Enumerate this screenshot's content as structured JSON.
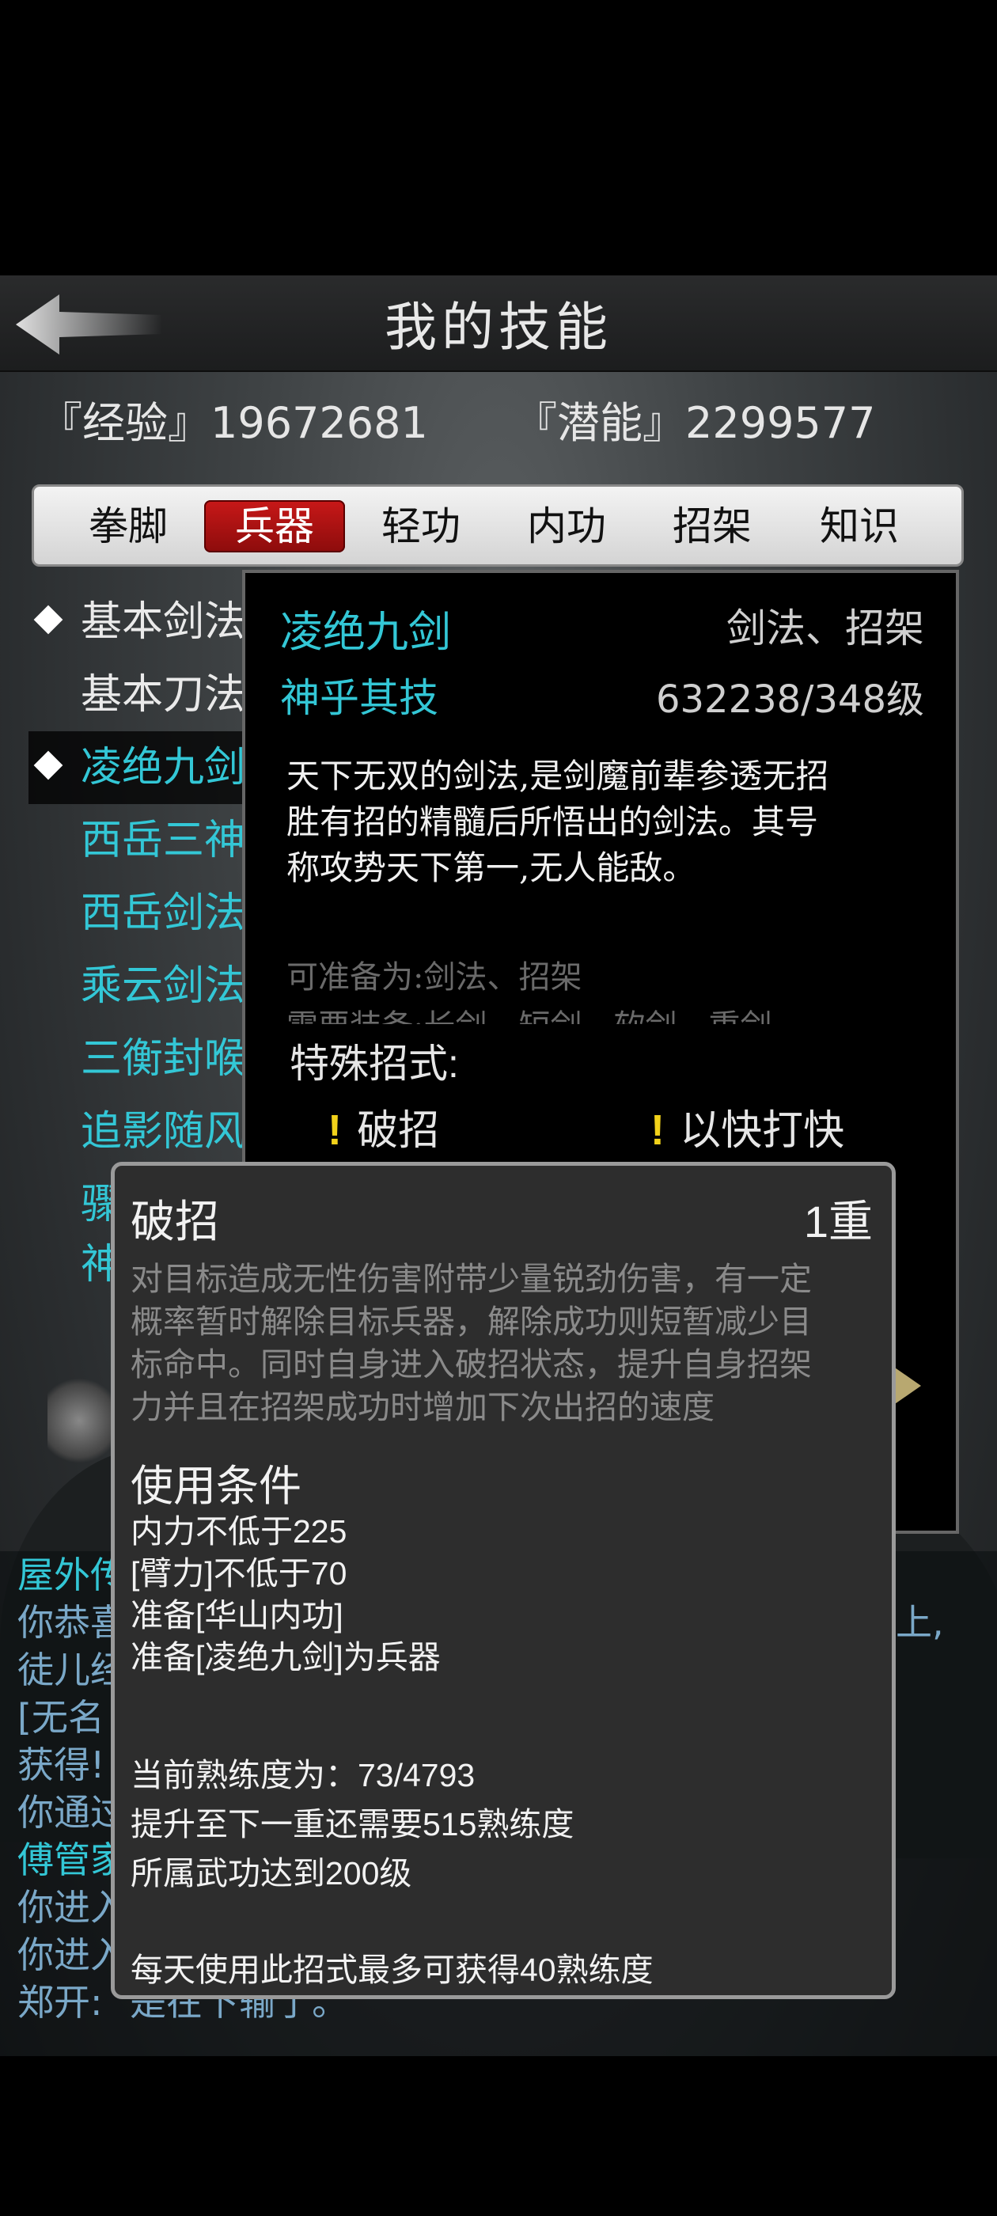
{
  "header": {
    "title": "我的技能"
  },
  "stats": {
    "exp_label": "『经验』19672681",
    "potential_label": "『潜能』2299577"
  },
  "tabs": [
    {
      "label": "拳脚"
    },
    {
      "label": "兵器"
    },
    {
      "label": "轻功"
    },
    {
      "label": "内功"
    },
    {
      "label": "招架"
    },
    {
      "label": "知识"
    }
  ],
  "active_tab": "兵器",
  "skill_list": [
    {
      "label": "基本剑法"
    },
    {
      "label": "基本刀法"
    },
    {
      "label": "凌绝九剑"
    },
    {
      "label": "西岳三神"
    },
    {
      "label": "西岳剑法"
    },
    {
      "label": "乘云剑法"
    },
    {
      "label": "三衡封喉"
    },
    {
      "label": "追影随风"
    },
    {
      "label": "骤"
    },
    {
      "label": "神"
    }
  ],
  "detail": {
    "name": "凌绝九剑",
    "type": "剑法、招架",
    "rank": "神乎其技",
    "progress": "632238/348级",
    "desc_lines": [
      "天下无双的剑法,是剑魔前辈参透无招",
      "胜有招的精髓后所悟出的剑法。其号",
      "称攻势天下第一,无人能敌。"
    ],
    "equip_as": "可准备为:剑法、招架",
    "equip_need": "需要装备:长剑、短剑、软剑、重剑",
    "special_title": "特殊招式:",
    "special_moves": [
      {
        "label": "破招"
      },
      {
        "label": "以快打快"
      }
    ]
  },
  "log": {
    "lines": [
      {
        "text": "屋外传",
        "color": "#33c7d6"
      },
      {
        "text": "你恭喜",
        "color": "#7aa8c8"
      },
      {
        "text": "徒儿经",
        "color": "#7aa8c8"
      },
      {
        "text": "[无名",
        "color": "#7aa8c8"
      },
      {
        "text": "获得!",
        "color": "#7aa8c8"
      },
      {
        "text": "你通过",
        "color": "#7aa8c8"
      },
      {
        "text": "傅管家",
        "color": "#33c7d6"
      },
      {
        "text": "你进入",
        "color": "#7aa8c8"
      },
      {
        "text": "你进入",
        "color": "#7aa8c8"
      }
    ],
    "right_fragment": "上,",
    "last_speaker": "郑开:",
    "last_text": "是在下输了。"
  },
  "popup": {
    "title": "破招",
    "level": "1重",
    "desc_lines": [
      "对目标造成无性伤害附带少量锐劲伤害，有一定",
      "概率暂时解除目标兵器，解除成功则短暂减少目",
      "标命中。同时自身进入破招状态，提升自身招架",
      "力并且在招架成功时增加下次出招的速度"
    ],
    "cond_title": "使用条件",
    "conditions": [
      "内力不低于225",
      "[臂力]不低于70",
      "准备[华山内功]",
      "准备[凌绝九剑]为兵器"
    ],
    "proficiency": "当前熟练度为：73/4793",
    "next_need": "提升至下一重还需要515熟练度",
    "req_level": "所属武功达到200级",
    "daily_cap": "每天使用此招式最多可获得40熟练度"
  },
  "colors": {
    "accent_cyan": "#33c7d6",
    "tab_active": "#b01010",
    "warn_yellow": "#f2d21a"
  }
}
